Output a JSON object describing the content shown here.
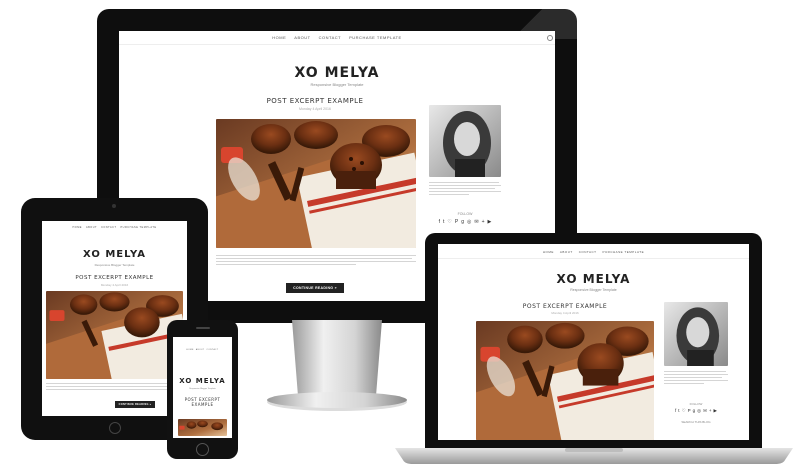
{
  "site": {
    "nav": [
      "HOME",
      "ABOUT",
      "CONTACT",
      "PURCHASE TEMPLATE"
    ],
    "title": "XO MELYA",
    "tagline": "Responsive Blogger Template",
    "post_title": "POST EXCERPT EXAMPLE",
    "post_date": "Monday 4 April 2016",
    "read_button": "CONTINUE READING »",
    "follow_label": "FOLLOW",
    "search_label": "SEARCH THIS BLOG",
    "social_icons": [
      "f",
      "t",
      "♡",
      "P",
      "g",
      "◎",
      "✉",
      "+",
      "▶"
    ],
    "about_text_lines": 5,
    "body_text_lines": 4
  },
  "colors": {
    "device_bezel": "#111111",
    "page_bg": "#ffffff",
    "button_bg": "#222222",
    "muffin_bg": "#5a2e19",
    "towel_red": "#c63a2a"
  }
}
